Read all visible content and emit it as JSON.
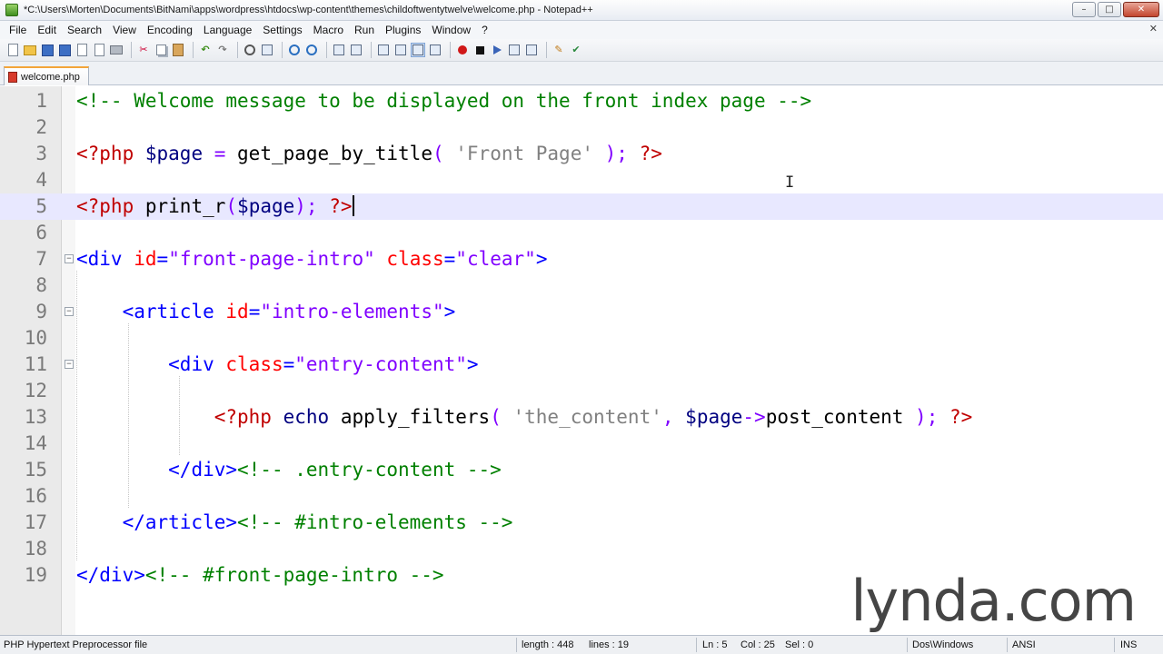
{
  "window": {
    "title": "*C:\\Users\\Morten\\Documents\\BitNami\\apps\\wordpress\\htdocs\\wp-content\\themes\\childoftwentytwelve\\welcome.php - Notepad++",
    "minimize": "–",
    "maximize": "□",
    "close": "✕"
  },
  "menu": {
    "items": [
      "File",
      "Edit",
      "Search",
      "View",
      "Encoding",
      "Language",
      "Settings",
      "Macro",
      "Run",
      "Plugins",
      "Window",
      "?"
    ],
    "close": "✕"
  },
  "toolbar": {
    "icons": [
      "new-file-icon",
      "open-file-icon",
      "save-icon",
      "save-all-icon",
      "close-icon",
      "close-all-icon",
      "print-icon",
      "cut-icon",
      "copy-icon",
      "paste-icon",
      "undo-icon",
      "redo-icon",
      "find-icon",
      "replace-icon",
      "zoom-in-icon",
      "zoom-out-icon",
      "sync-v-icon",
      "sync-h-icon",
      "word-wrap-icon",
      "all-chars-icon",
      "indent-guide-icon",
      "doc-map-icon",
      "record-macro-icon",
      "stop-macro-icon",
      "play-macro-icon",
      "run-macro-multiple-icon",
      "save-macro-icon",
      "edit-icon",
      "spell-check-icon"
    ],
    "glyphs": {
      "cut": "✂",
      "undo": "↶",
      "redo": "↷",
      "edit": "✎",
      "check": "✔"
    }
  },
  "tabs": [
    {
      "label": "welcome.php",
      "active": true
    }
  ],
  "editor": {
    "current_line": 5,
    "lines": [
      {
        "n": "1",
        "foldable": false,
        "tokens": [
          {
            "t": "<!-- Welcome message to be displayed on the front index page -->",
            "c": "cmt"
          }
        ]
      },
      {
        "n": "2",
        "foldable": false,
        "tokens": []
      },
      {
        "n": "3",
        "foldable": false,
        "tokens": [
          {
            "t": "<?php",
            "c": "php"
          },
          {
            "t": " ",
            "c": "fn"
          },
          {
            "t": "$page",
            "c": "var"
          },
          {
            "t": " = ",
            "c": "op"
          },
          {
            "t": "get_page_by_title",
            "c": "fn"
          },
          {
            "t": "( ",
            "c": "op"
          },
          {
            "t": "'Front Page'",
            "c": "str"
          },
          {
            "t": " ); ",
            "c": "op"
          },
          {
            "t": "?>",
            "c": "php"
          }
        ]
      },
      {
        "n": "4",
        "foldable": false,
        "tokens": []
      },
      {
        "n": "5",
        "foldable": false,
        "tokens": [
          {
            "t": "<?php",
            "c": "php"
          },
          {
            "t": " ",
            "c": "fn"
          },
          {
            "t": "print_r",
            "c": "fn"
          },
          {
            "t": "(",
            "c": "op"
          },
          {
            "t": "$page",
            "c": "var"
          },
          {
            "t": "); ",
            "c": "op"
          },
          {
            "t": "?>",
            "c": "php"
          }
        ],
        "cursor": true
      },
      {
        "n": "6",
        "foldable": false,
        "tokens": []
      },
      {
        "n": "7",
        "foldable": true,
        "tokens": [
          {
            "t": "<div",
            "c": "tag"
          },
          {
            "t": " ",
            "c": "fn"
          },
          {
            "t": "id",
            "c": "attr"
          },
          {
            "t": "=",
            "c": "tag"
          },
          {
            "t": "\"front-page-intro\"",
            "c": "val"
          },
          {
            "t": " ",
            "c": "fn"
          },
          {
            "t": "class",
            "c": "attr"
          },
          {
            "t": "=",
            "c": "tag"
          },
          {
            "t": "\"clear\"",
            "c": "val"
          },
          {
            "t": ">",
            "c": "tag"
          }
        ]
      },
      {
        "n": "8",
        "foldable": false,
        "tokens": []
      },
      {
        "n": "9",
        "foldable": true,
        "tokens": [
          {
            "t": "    ",
            "c": "fn"
          },
          {
            "t": "<article",
            "c": "tag"
          },
          {
            "t": " ",
            "c": "fn"
          },
          {
            "t": "id",
            "c": "attr"
          },
          {
            "t": "=",
            "c": "tag"
          },
          {
            "t": "\"intro-elements\"",
            "c": "val"
          },
          {
            "t": ">",
            "c": "tag"
          }
        ]
      },
      {
        "n": "10",
        "foldable": false,
        "tokens": []
      },
      {
        "n": "11",
        "foldable": true,
        "tokens": [
          {
            "t": "        ",
            "c": "fn"
          },
          {
            "t": "<div",
            "c": "tag"
          },
          {
            "t": " ",
            "c": "fn"
          },
          {
            "t": "class",
            "c": "attr"
          },
          {
            "t": "=",
            "c": "tag"
          },
          {
            "t": "\"entry-content\"",
            "c": "val"
          },
          {
            "t": ">",
            "c": "tag"
          }
        ]
      },
      {
        "n": "12",
        "foldable": false,
        "tokens": []
      },
      {
        "n": "13",
        "foldable": false,
        "tokens": [
          {
            "t": "            ",
            "c": "fn"
          },
          {
            "t": "<?php",
            "c": "php"
          },
          {
            "t": " ",
            "c": "fn"
          },
          {
            "t": "echo",
            "c": "kw"
          },
          {
            "t": " ",
            "c": "fn"
          },
          {
            "t": "apply_filters",
            "c": "fn"
          },
          {
            "t": "( ",
            "c": "op"
          },
          {
            "t": "'the_content'",
            "c": "str"
          },
          {
            "t": ", ",
            "c": "op"
          },
          {
            "t": "$page",
            "c": "var"
          },
          {
            "t": "->",
            "c": "op"
          },
          {
            "t": "post_content",
            "c": "fn"
          },
          {
            "t": " ); ",
            "c": "op"
          },
          {
            "t": "?>",
            "c": "php"
          }
        ]
      },
      {
        "n": "14",
        "foldable": false,
        "tokens": []
      },
      {
        "n": "15",
        "foldable": false,
        "tokens": [
          {
            "t": "        ",
            "c": "fn"
          },
          {
            "t": "</div>",
            "c": "tag"
          },
          {
            "t": "<!-- .entry-content -->",
            "c": "cmt"
          }
        ]
      },
      {
        "n": "16",
        "foldable": false,
        "tokens": []
      },
      {
        "n": "17",
        "foldable": false,
        "tokens": [
          {
            "t": "    ",
            "c": "fn"
          },
          {
            "t": "</article>",
            "c": "tag"
          },
          {
            "t": "<!-- #intro-elements -->",
            "c": "cmt"
          }
        ]
      },
      {
        "n": "18",
        "foldable": false,
        "tokens": []
      },
      {
        "n": "19",
        "foldable": false,
        "tokens": [
          {
            "t": "</div>",
            "c": "tag"
          },
          {
            "t": "<!-- #front-page-intro -->",
            "c": "cmt"
          }
        ]
      }
    ],
    "fold_glyph": "−"
  },
  "mouse_cursor": "I",
  "watermark": "lynda.com",
  "status": {
    "file_type": "PHP Hypertext Preprocessor file",
    "length": "length : 448",
    "lines": "lines : 19",
    "ln": "Ln : 5",
    "col": "Col : 25",
    "sel": "Sel : 0",
    "eol": "Dos\\Windows",
    "encoding": "ANSI",
    "mode": "INS"
  },
  "colors": {
    "comment": "#008000",
    "php_tag": "#c00000",
    "variable": "#000080",
    "operator": "#8000ff",
    "string": "#808080",
    "html_tag": "#0000ff",
    "attribute": "#ff0000",
    "attr_value": "#8000ff",
    "current_line_bg": "#e8e8ff",
    "tab_accent": "#f3a53a"
  }
}
